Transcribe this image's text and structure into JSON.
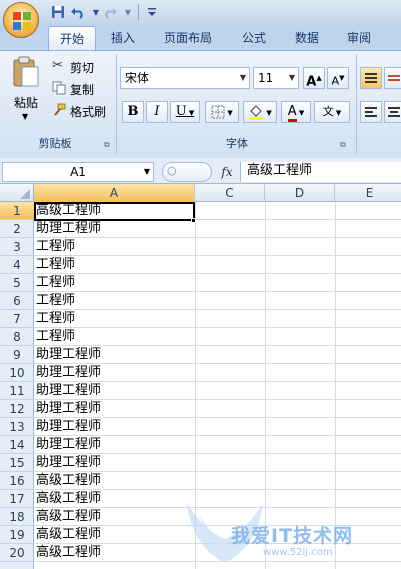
{
  "title_bar": {
    "qat": [
      "save-icon",
      "undo-icon",
      "redo-icon",
      "customize-icon"
    ]
  },
  "ribbon": {
    "tabs": [
      {
        "label": "开始",
        "active": true
      },
      {
        "label": "插入",
        "active": false
      },
      {
        "label": "页面布局",
        "active": false
      },
      {
        "label": "公式",
        "active": false
      },
      {
        "label": "数据",
        "active": false
      },
      {
        "label": "审阅",
        "active": false
      }
    ],
    "clipboard": {
      "paste": "粘贴",
      "cut": "剪切",
      "copy": "复制",
      "format_painter": "格式刷",
      "group_label": "剪贴板"
    },
    "font": {
      "font_name": "宋体",
      "font_size": "11",
      "bold": "B",
      "italic": "I",
      "underline": "U",
      "grow": "A",
      "shrink": "A",
      "group_label": "字体"
    }
  },
  "formula_bar": {
    "name_box": "A1",
    "fx": "fx",
    "value": "高级工程师"
  },
  "grid": {
    "columns": [
      "A",
      "C",
      "D",
      "E"
    ],
    "selected_column": "A",
    "rows": [
      {
        "n": "1",
        "a": "高级工程师"
      },
      {
        "n": "2",
        "a": "助理工程师"
      },
      {
        "n": "3",
        "a": "工程师"
      },
      {
        "n": "4",
        "a": "工程师"
      },
      {
        "n": "5",
        "a": "工程师"
      },
      {
        "n": "6",
        "a": "工程师"
      },
      {
        "n": "7",
        "a": "工程师"
      },
      {
        "n": "8",
        "a": "工程师"
      },
      {
        "n": "9",
        "a": "助理工程师"
      },
      {
        "n": "10",
        "a": "助理工程师"
      },
      {
        "n": "11",
        "a": "助理工程师"
      },
      {
        "n": "12",
        "a": "助理工程师"
      },
      {
        "n": "13",
        "a": "助理工程师"
      },
      {
        "n": "14",
        "a": "助理工程师"
      },
      {
        "n": "15",
        "a": "助理工程师"
      },
      {
        "n": "16",
        "a": "高级工程师"
      },
      {
        "n": "17",
        "a": "高级工程师"
      },
      {
        "n": "18",
        "a": "高级工程师"
      },
      {
        "n": "19",
        "a": "高级工程师"
      },
      {
        "n": "20",
        "a": "高级工程师"
      }
    ]
  },
  "watermark": {
    "text": "我爱IT技术网",
    "url": "www.52ij.com"
  }
}
